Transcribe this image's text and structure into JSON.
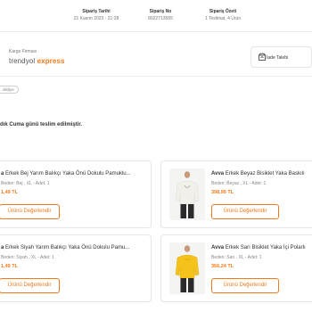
{
  "order_summary": {
    "date_label": "Sipariş Tarihi",
    "date_value": "21 Kasım 2023 - 21:28",
    "number_label": "Sipariş No",
    "number_value": "8022713565",
    "summary_label": "Sipariş Özeti",
    "summary_value": "1 Teslimat, 4 Ürün"
  },
  "cargo": {
    "label": "Kargo Firması",
    "logo_main": "trendyol ",
    "logo_accent": "express"
  },
  "return_button": {
    "label": "İade Talebi"
  },
  "status_badge": "dildiye",
  "delivery_text": "dık Cuma günü teslim edilmiştir.",
  "products": [
    {
      "brand": "a",
      "name": "Erkek Bej Yarım Balıkçı Yaka Önü Dokulu Pamuklu...",
      "meta": "Beden: Bej , XL - Adet: 1",
      "price": "1,49 TL",
      "button": "Ürünü Değerlendir"
    },
    {
      "brand": "Avva",
      "name": "Erkek Beyaz Bisiklet Yaka Baskılı",
      "meta": "Beden: Beyaz , XL - Adet: 1",
      "price": "398,99 TL",
      "button": "Ürünü Değerlendir"
    },
    {
      "brand": "a",
      "name": "Erkek Siyah Yarım Balıkçı Yaka Önü Dokulu Pamu...",
      "meta": "Beden: Siyah , XL - Adet: 1",
      "price": "1,49 TL",
      "button": "Ürünü Değerlendir"
    },
    {
      "brand": "Avva",
      "name": "Erkek Sarı Bisiklet Yaka İçi Polarlı",
      "meta": "Beden: Sarı , XL - Adet: 1",
      "price": "356,24 TL",
      "button": "Ürünü Değerlendir"
    }
  ],
  "colors": {
    "accent": "#f27a1a",
    "border": "#e6e6e6",
    "muted": "#888888"
  },
  "icons": {
    "return": "return-box-icon"
  }
}
